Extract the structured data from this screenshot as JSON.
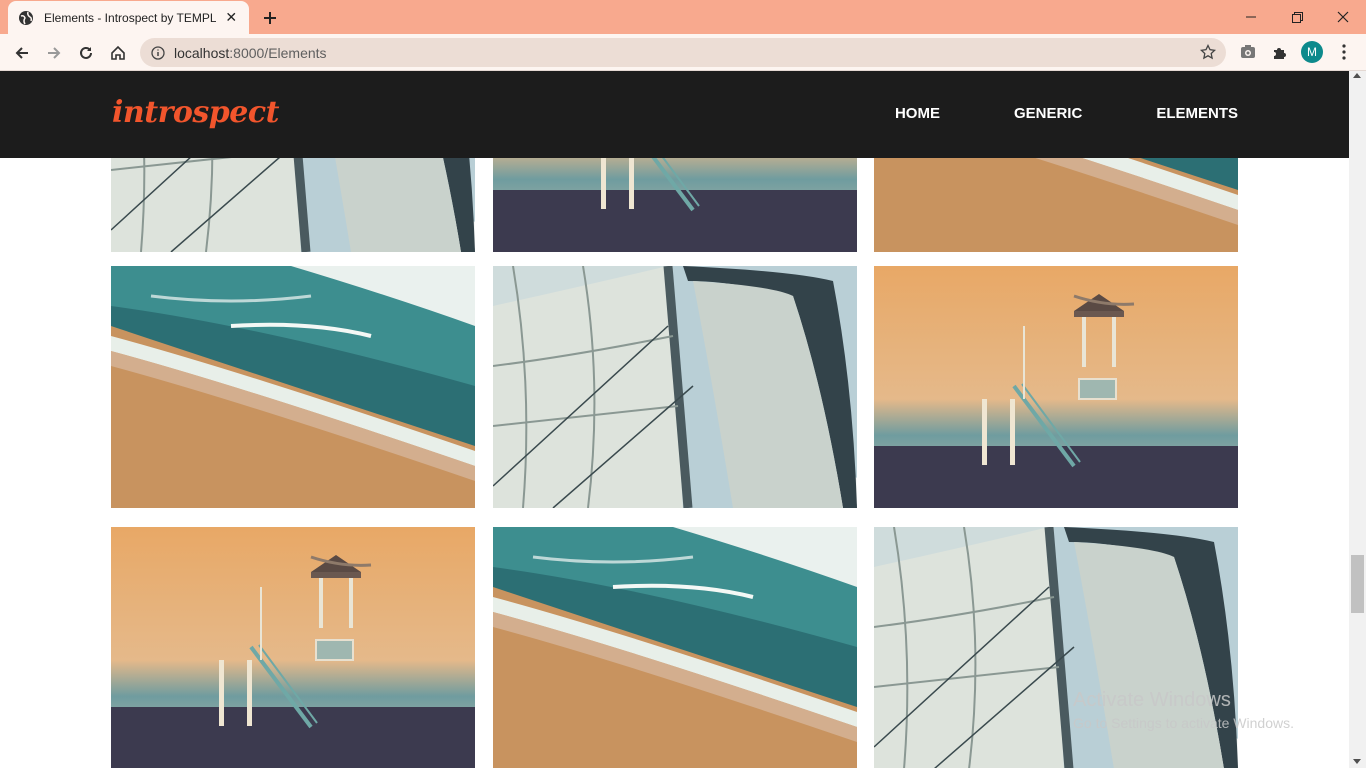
{
  "browser": {
    "tab_title": "Elements - Introspect by TEMPLA",
    "url_host": "localhost",
    "url_path": ":8000/Elements",
    "profile_initial": "M"
  },
  "site": {
    "logo": "introspect",
    "nav": [
      {
        "label": "HOME"
      },
      {
        "label": "GENERIC"
      },
      {
        "label": "ELEMENTS"
      }
    ]
  },
  "gallery": {
    "rows": [
      [
        "sail",
        "lifeguard",
        "beach"
      ],
      [
        "beach",
        "sail",
        "lifeguard"
      ],
      [
        "lifeguard",
        "beach",
        "sail"
      ]
    ]
  },
  "watermark": {
    "line1": "Activate Windows",
    "line2": "Go to Settings to activate Windows."
  }
}
